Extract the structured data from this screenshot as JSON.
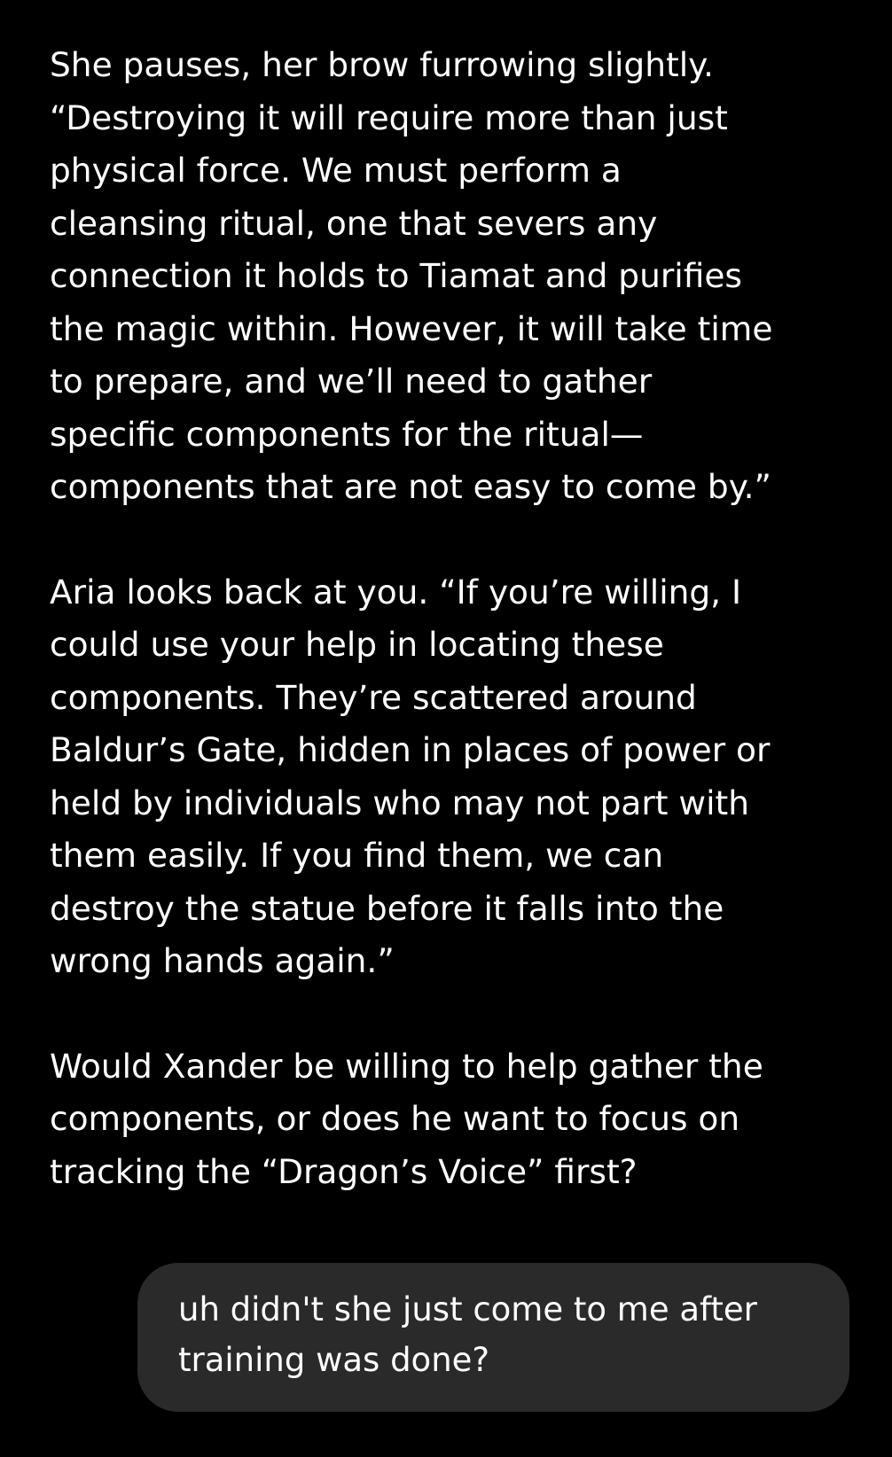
{
  "assistant": {
    "paragraphs": [
      "She pauses, her brow furrowing slightly.\n“Destroying it will require more than just\nphysical force. We must perform a\ncleansing ritual, one that severs any\nconnection it holds to Tiamat and purifies\nthe magic within. However, it will take time\nto prepare, and we’ll need to gather\nspecific components for the ritual—\ncomponents that are not easy to come by.”",
      "Aria looks back at you. “If you’re willing, I\ncould use your help in locating these\ncomponents. They’re scattered around\nBaldur’s Gate, hidden in places of power or\nheld by individuals who may not part with\nthem easily. If you find them, we can\ndestroy the statue before it falls into the\nwrong hands again.”",
      "Would Xander be willing to help gather the\ncomponents, or does he want to focus on\ntracking the “Dragon’s Voice” first?"
    ]
  },
  "user": {
    "message": "uh didn't she just come to me after\ntraining was done?"
  },
  "colors": {
    "background": "#000000",
    "text": "#ffffff",
    "user_bubble": "#2a2a2a"
  }
}
